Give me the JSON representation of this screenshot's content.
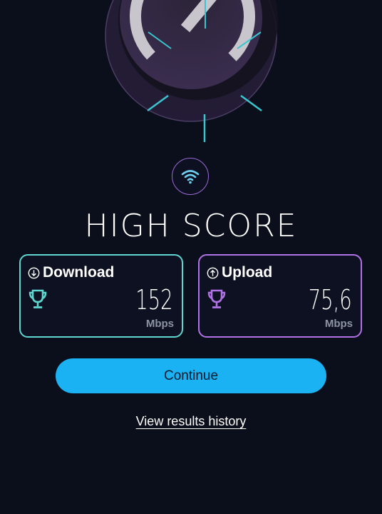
{
  "result": {
    "headline": "HIGH SCORE",
    "gauge_icon": "speedometer-gauge",
    "status_icon": "wifi-icon"
  },
  "download": {
    "label": "Download",
    "icon": "arrow-down-circle-icon",
    "trophy_icon": "trophy-icon",
    "value": "152",
    "unit": "Mbps",
    "accent_color": "#5fd6d0"
  },
  "upload": {
    "label": "Upload",
    "icon": "arrow-up-circle-icon",
    "trophy_icon": "trophy-icon",
    "value": "75,6",
    "unit": "Mbps",
    "accent_color": "#b072e6"
  },
  "actions": {
    "continue_label": "Continue",
    "history_label": "View results history",
    "button_color": "#1ab2f2"
  }
}
